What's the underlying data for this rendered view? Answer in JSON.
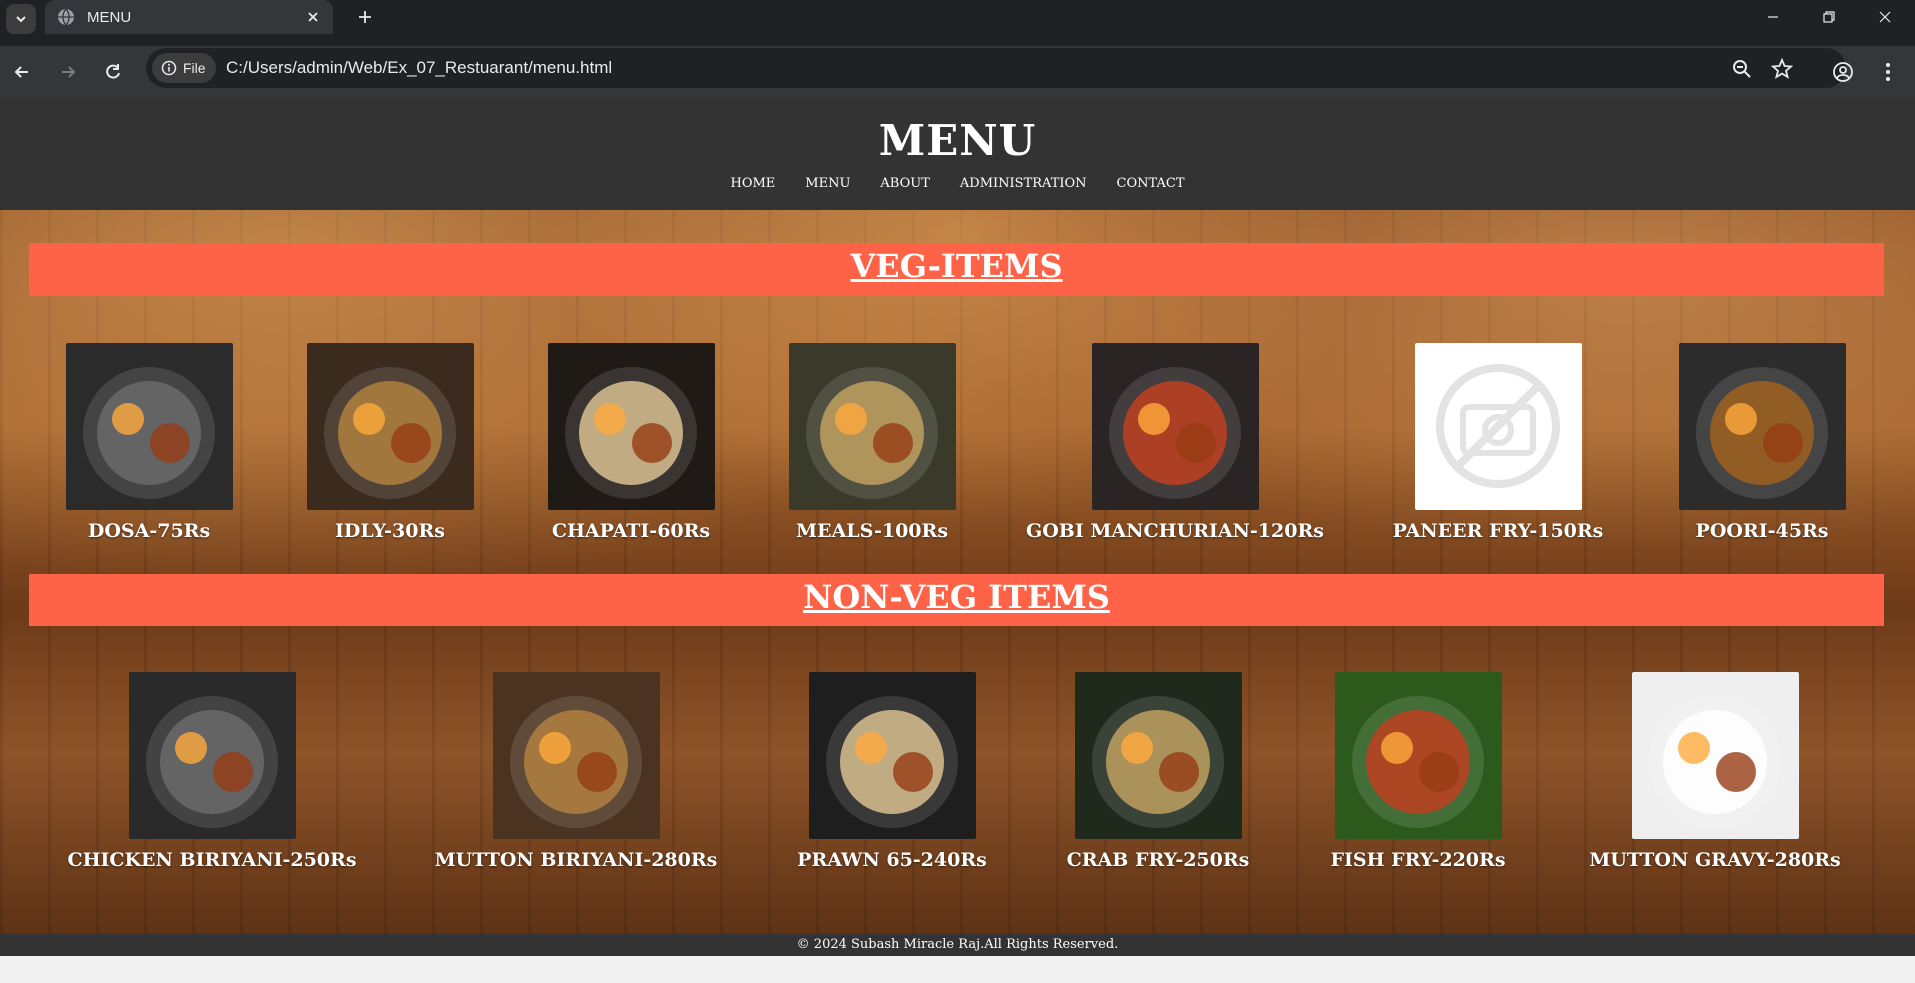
{
  "browser": {
    "tab_title": "MENU",
    "chip_label": "File",
    "url": "C:/Users/admin/Web/Ex_07_Restuarant/menu.html"
  },
  "page": {
    "title": "MENU",
    "nav": [
      "HOME",
      "MENU",
      "ABOUT",
      "ADMINISTRATION",
      "CONTACT"
    ],
    "veg_heading": "VEG-ITEMS",
    "nonveg_heading": "NON-VEG ITEMS",
    "footer": "© 2024 Subash Miracle Raj.All Rights Reserved."
  },
  "veg_items": [
    {
      "label": "DOSA-75Rs",
      "photo": "dosa-photo",
      "color": "#2b2b2b"
    },
    {
      "label": "IDLY-30Rs",
      "photo": "idly-photo",
      "color": "#3b2a1e"
    },
    {
      "label": "CHAPATI-60Rs",
      "photo": "chapati-photo",
      "color": "#1f1a16"
    },
    {
      "label": "MEALS-100Rs",
      "photo": "meals-photo",
      "color": "#3a3a2a"
    },
    {
      "label": "GOBI MANCHURIAN-120Rs",
      "photo": "gobi-manchurian-photo",
      "color": "#2a2424"
    },
    {
      "label": "PANEER FRY-150Rs",
      "photo": "broken-image-placeholder",
      "color": "#ffffff"
    },
    {
      "label": "POORI-45Rs",
      "photo": "poori-photo",
      "color": "#2c2c2c"
    }
  ],
  "nonveg_items": [
    {
      "label": "CHICKEN BIRIYANI-250Rs",
      "photo": "chicken-biriyani-photo",
      "color": "#2a2a2a"
    },
    {
      "label": "MUTTON BIRIYANI-280Rs",
      "photo": "mutton-biriyani-photo",
      "color": "#4a3320"
    },
    {
      "label": "PRAWN 65-240Rs",
      "photo": "prawn-65-photo",
      "color": "#1e1e1e"
    },
    {
      "label": "CRAB FRY-250Rs",
      "photo": "crab-fry-photo",
      "color": "#1f2a1c"
    },
    {
      "label": "FISH FRY-220Rs",
      "photo": "fish-fry-photo",
      "color": "#2b5a1c"
    },
    {
      "label": "MUTTON GRAVY-280Rs",
      "photo": "mutton-gravy-photo",
      "color": "#efefef"
    }
  ]
}
